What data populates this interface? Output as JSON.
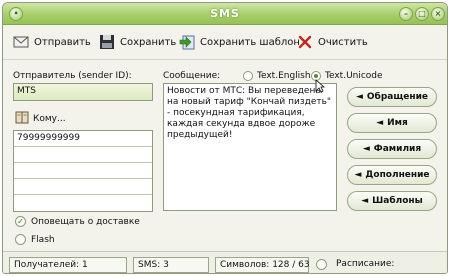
{
  "window": {
    "title": "SMS"
  },
  "toolbar": {
    "send_label": "Отправить",
    "save_label": "Сохранить",
    "save_template_label": "Сохранить шаблон",
    "clear_label": "Очистить"
  },
  "sender": {
    "label": "Отправитель (sender ID):",
    "value": "MTS"
  },
  "recipients": {
    "button_label": "Кому...",
    "items": [
      "79999999999",
      "",
      "",
      ""
    ]
  },
  "message": {
    "label": "Сообщение:",
    "encoding": {
      "english_label": "Text.English",
      "unicode_label": "Text.Unicode",
      "selected": "unicode"
    },
    "text": "Новости от МТС: Вы переведены на новый тариф \"Кончай пиздеть\" - посекундная тарификация, каждая секунда вдвое дороже предыдущей!"
  },
  "side_buttons": {
    "address_label": "Обращение",
    "name_label": "Имя",
    "surname_label": "Фамилия",
    "addition_label": "Дополнение",
    "templates_label": "Шаблоны"
  },
  "options": {
    "delivery_report_label": "Оповещать о доставке",
    "delivery_report_checked": true,
    "flash_label": "Flash",
    "flash_checked": false
  },
  "status": {
    "recipients": "Получателей: 1",
    "sms_count": "SMS: 3",
    "symbols": "Символов: 128 / 63",
    "schedule": "Расписание:"
  },
  "colors": {
    "title_bar": "#a8cf6a",
    "accent_green": "#5d8a2b",
    "clear_icon": "#c0281c"
  }
}
